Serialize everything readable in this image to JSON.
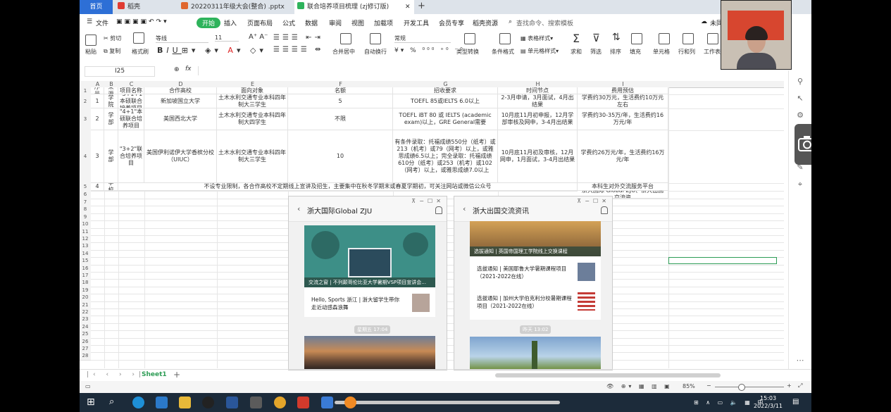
{
  "tabs": {
    "home": "首页",
    "daoke": "稻壳",
    "pptx": "20220311年级大会(整合) .pptx",
    "xlsx": "联合培养项目梳理 (zj修订版)"
  },
  "menu": [
    "文件",
    "开始",
    "插入",
    "页面布局",
    "公式",
    "数据",
    "审阅",
    "视图",
    "加载项",
    "开发工具",
    "会员专享",
    "稻壳资源"
  ],
  "search_placeholder": "查找命令、搜索模板",
  "toolbar": {
    "cut": "剪切",
    "paste": "粘贴",
    "copy": "复制",
    "format_painter": "格式刷",
    "font": "等线",
    "size": "11",
    "merge": "合并居中",
    "wrap": "自动换行",
    "numfmt": "常规",
    "convert": "类型转换",
    "cond": "条件格式",
    "table_style": "表格样式",
    "cell_style": "单元格样式",
    "sum": "求和",
    "filter": "筛选",
    "sort": "排序",
    "fill": "填充",
    "cells": "单元格",
    "rowcol": "行和列",
    "sheet": "工作表",
    "unsaved": "未同"
  },
  "namebox": "I25",
  "fx": "fx",
  "columns": [
    "A",
    "B",
    "C",
    "D",
    "E",
    "F",
    "G",
    "H",
    "I"
  ],
  "rows": [
    [
      "序号",
      "来源",
      "项目名称",
      "合作高校",
      "面向对象",
      "名额",
      "招收要求",
      "时间节点",
      "费用预估"
    ],
    [
      "1",
      "学院",
      "\"3+1+1本硕联合培养项目",
      "新加坡国立大学",
      "土木水利交通专业本科四年制大三学生",
      "5",
      "TOEFL 85或IELTS 6.0以上",
      "2-3月申请，3月面试，4月出结果",
      "学费约30万元，生活费约10万元左右"
    ],
    [
      "2",
      "学部",
      "\"4+1\"本硕联合培养项目",
      "美国西北大学",
      "土木水利交通专业本科四年制大四学生",
      "不限",
      "TOEFL iBT 80 或 IELTS (academic exam)以上，GRE General需要",
      "10月底11月初申报，12月学部审核及网申，3-4月出结果",
      "学费约30-35万/年，生活费约16万元/年"
    ],
    [
      "3",
      "学部",
      "\"3+2\"联合培养项目",
      "美国伊利诺伊大学香槟分校（UIUC）",
      "土木水利交通专业本科四年制大三学生",
      "10",
      "有条件录取：托福成绩550分（纸考）或213（机考）或79（网考）以上，或雅思成绩6.5以上；完全录取：托福成绩610分（纸考）或253（机考）或102（网考）以上，或雅思成绩7.0以上",
      "10月底11月初及审核，12月网申，1月面试，3-4月出结果",
      "学费约26万元/年，生活费约16万元/年"
    ],
    [
      "4",
      "学校",
      "不设专业限制，各合作高校不定期线上宣讲及招生，主要集中在秋冬学期末或春夏学期初，可关注网站或微信公众号",
      "",
      "",
      "",
      "",
      "",
      "本科生对外交流服务平台"
    ],
    [
      "",
      "",
      "",
      "",
      "",
      "",
      "",
      "",
      "浙大国际 Global ZJU、浙大出国交流资"
    ]
  ],
  "row_numbers": [
    "1",
    "2",
    "3",
    "4",
    "5",
    "6",
    "7",
    "8",
    "9",
    "10",
    "11",
    "12",
    "13",
    "14",
    "15",
    "16",
    "17",
    "18",
    "19",
    "20",
    "21",
    "22",
    "23",
    "24",
    "25",
    "26",
    "27",
    "28"
  ],
  "sheet_tab": "Sheet1",
  "zoom": "85%",
  "panel_left": {
    "title": "浙大国际Global ZJU",
    "banner": "交流之窗 | 不列颠哥伦比亚大学暑期VSP项目宣讲会...",
    "article": "Hello, Sports 浙江 | 浙大留学生带你走近动感森浪舞",
    "date": "星期五 17:04"
  },
  "panel_right": {
    "title": "浙大出国交流资讯",
    "banner": "选拔通知 | 英国帝国理工学院线上交换课程",
    "article1": "选拔通知 | 美国耶鲁大学暑期课程项目（2021-2022在线）",
    "article2": "选拔通知 | 加州大学伯克利分校暑期课程项目（2021-2022在线）",
    "date": "昨天 13:02"
  },
  "clock": {
    "time": "15:03",
    "date": "2022/3/11"
  },
  "colors": {
    "accent_green": "#2eb35b",
    "home_tab": "#2d6fd6",
    "taskbar": "#1c2b3a"
  }
}
